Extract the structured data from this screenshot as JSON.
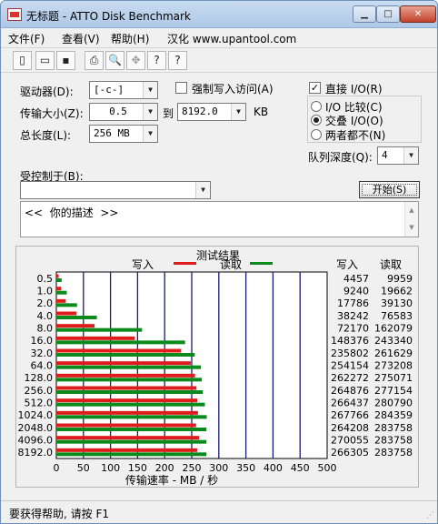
{
  "window": {
    "title": "无标题 - ATTO Disk Benchmark"
  },
  "window_controls": {
    "minimize": "▁",
    "maximize": "□",
    "close": "✕"
  },
  "menu": {
    "file": "文件(F)",
    "view": "查看(V)",
    "help": "帮助(H)",
    "localized": "汉化 www.upantool.com"
  },
  "toolbar": [
    "new-file-icon",
    "open-folder-icon",
    "save-icon",
    "print-icon",
    "print-preview-icon",
    "move-icon",
    "help-icon",
    "context-help-icon"
  ],
  "toolbar_glyphs": {
    "new": "▯",
    "open": "▭",
    "save": "▪",
    "print": "⎙",
    "preview": "🔍",
    "move": "✥",
    "help": "?",
    "context": "?"
  },
  "form": {
    "drive_label": "驱动器(D):",
    "drive_value": "[-c-]",
    "transfer_label": "传输大小(Z):",
    "transfer_from": "0.5",
    "to_label": "到",
    "transfer_to": "8192.0",
    "kb_label": "KB",
    "total_label": "总长度(L):",
    "total_value": "256 MB",
    "force_write_label": "强制写入访问(A)",
    "force_write_checked": false,
    "direct_io_label": "直接 I/O(R)",
    "direct_io_checked": true,
    "radio_io_compare": "I/O 比较(C)",
    "radio_overlapped": "交叠 I/O(O)",
    "radio_neither": "两者都不(N)",
    "queue_label": "队列深度(Q):",
    "queue_value": "4",
    "controlled_label": "受控制于(B):",
    "controlled_value": "",
    "start_button": "开始(S)",
    "description": "<<  你的描述  >>"
  },
  "results": {
    "title": "测试结果",
    "write_legend": "写入",
    "read_legend": "读取",
    "write_col": "写入",
    "read_col": "读取",
    "xlabel": "传输速率 - MB / 秒"
  },
  "colors": {
    "write": "#e01b1b",
    "read": "#0a8a1a",
    "grid": "#1a1a7a"
  },
  "chart_data": {
    "type": "bar",
    "orientation": "horizontal",
    "title": "测试结果",
    "xlabel": "传输速率 - MB / 秒",
    "xlim": [
      0,
      500
    ],
    "xticks": [
      0,
      50,
      100,
      150,
      200,
      250,
      300,
      350,
      400,
      450,
      500
    ],
    "categories": [
      "0.5",
      "1.0",
      "2.0",
      "4.0",
      "8.0",
      "16.0",
      "32.0",
      "64.0",
      "128.0",
      "256.0",
      "512.0",
      "1024.0",
      "2048.0",
      "4096.0",
      "8192.0"
    ],
    "series": [
      {
        "name": "写入",
        "values": [
          4457,
          9240,
          17786,
          38242,
          72170,
          148376,
          235802,
          254154,
          262272,
          264876,
          266437,
          267766,
          264208,
          270055,
          266305
        ]
      },
      {
        "name": "读取",
        "values": [
          9959,
          19662,
          39130,
          76583,
          162079,
          243340,
          261629,
          273208,
          275071,
          277154,
          280790,
          284359,
          283758,
          283758,
          283758
        ]
      }
    ],
    "unit_scale": "KB/s",
    "grid": true,
    "legend": "top"
  },
  "status": {
    "text": "要获得帮助, 请按 F1"
  }
}
